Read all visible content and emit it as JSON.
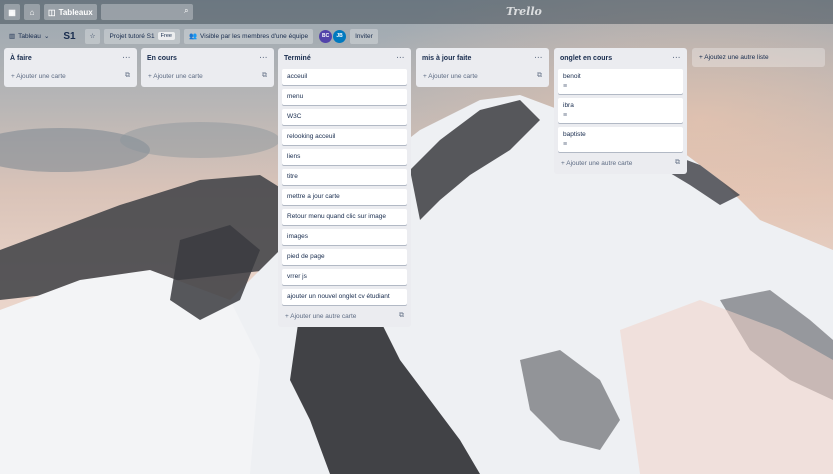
{
  "topbar": {
    "home_icon": "home-icon",
    "apps_icon": "apps-icon",
    "boards_label": "Tableaux",
    "search_placeholder": "",
    "logo": "Trello"
  },
  "boardbar": {
    "view_label": "Tableau",
    "board_title": "S1",
    "team_label": "Projet tutoré S1",
    "free_badge": "Free",
    "visibility_label": "Visible par les membres d'une équipe",
    "members": [
      "BC",
      "JB"
    ],
    "member_colors": [
      "#5243aa",
      "#0079bf"
    ],
    "invite_label": "Inviter"
  },
  "lists": [
    {
      "title": "À faire",
      "cards": [],
      "add_label": "+ Ajouter une carte"
    },
    {
      "title": "En cours",
      "cards": [],
      "add_label": "+ Ajouter une carte"
    },
    {
      "title": "Terminé",
      "cards": [
        {
          "title": "acceuil"
        },
        {
          "title": "menu"
        },
        {
          "title": "W3C"
        },
        {
          "title": "relooking acceuil"
        },
        {
          "title": "liens"
        },
        {
          "title": "titre"
        },
        {
          "title": "mettre a jour carte"
        },
        {
          "title": "Retour menu quand clic sur image"
        },
        {
          "title": "images"
        },
        {
          "title": "pied de page"
        },
        {
          "title": "vrrer js"
        },
        {
          "title": "ajouter un nouvel onglet cv étudiant"
        }
      ],
      "add_label": "+ Ajouter une autre carte"
    },
    {
      "title": "mis à jour faite",
      "cards": [],
      "add_label": "+ Ajouter une carte"
    },
    {
      "title": "onglet en cours",
      "cards": [
        {
          "title": "benoit",
          "desc_icon": "description-icon"
        },
        {
          "title": "ibra",
          "desc_icon": "description-icon"
        },
        {
          "title": "baptiste",
          "desc_icon": "description-icon"
        }
      ],
      "add_label": "+ Ajouter une autre carte"
    }
  ],
  "add_list_label": "+ Ajoutez une autre liste"
}
